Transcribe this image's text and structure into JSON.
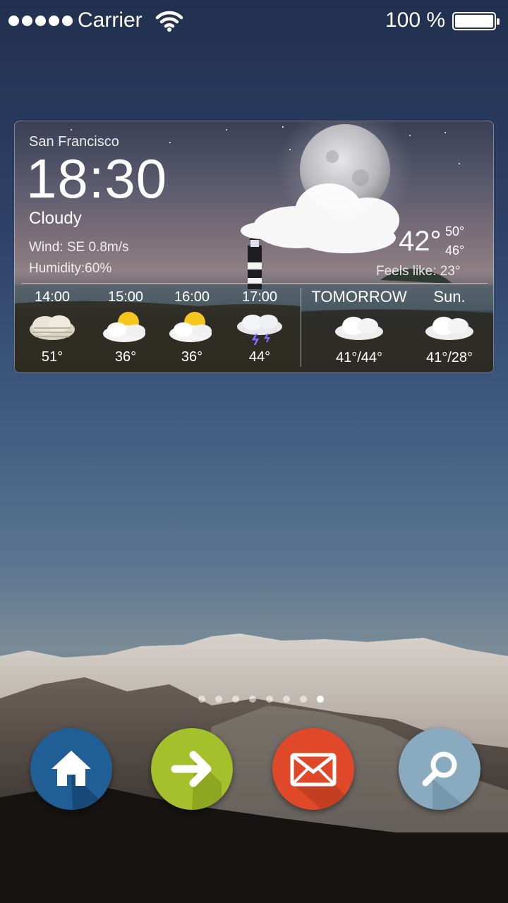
{
  "status_bar": {
    "carrier": "Carrier",
    "battery_percent": "100 %",
    "signal_bars": 5
  },
  "weather": {
    "city": "San Francisco",
    "time": "18:30",
    "condition": "Cloudy",
    "wind": "Wind:  SE 0.8m/s",
    "humidity": "Humidity:60%",
    "current_temp": "42°",
    "high_temp": "50°",
    "low_temp": "46°",
    "feels_like": "Feels like: 23°",
    "hourly": [
      {
        "time": "14:00",
        "icon": "partly-cloudy-haze-icon",
        "temp": "51°"
      },
      {
        "time": "15:00",
        "icon": "sun-cloud-icon",
        "temp": "36°"
      },
      {
        "time": "16:00",
        "icon": "sun-cloud-icon",
        "temp": "36°"
      },
      {
        "time": "17:00",
        "icon": "thunderstorm-icon",
        "temp": "44°"
      }
    ],
    "daily": [
      {
        "day": "TOMORROW",
        "icon": "cloudy-icon",
        "temp": "41°/44°"
      },
      {
        "day": "Sun.",
        "icon": "cloudy-icon",
        "temp": "41°/28°"
      }
    ]
  },
  "pages": {
    "count": 8,
    "active": 8
  },
  "dock": [
    {
      "icon": "home-icon",
      "color": "#1f5f96"
    },
    {
      "icon": "arrow-right-icon",
      "color": "#a4c02a"
    },
    {
      "icon": "mail-icon",
      "color": "#e0482a"
    },
    {
      "icon": "search-icon",
      "color": "#8aaac0"
    }
  ]
}
